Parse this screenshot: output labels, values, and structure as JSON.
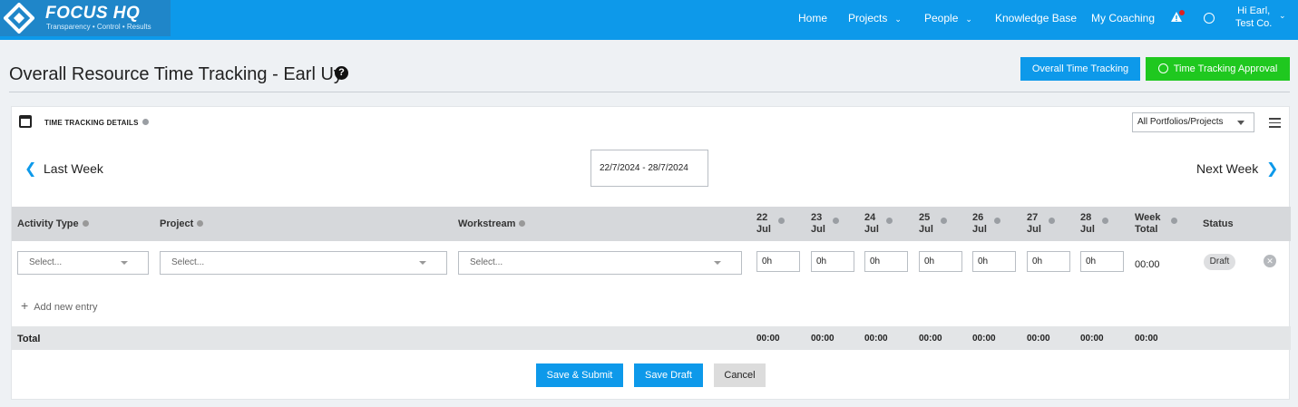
{
  "nav": {
    "logo_title": "FOCUS HQ",
    "logo_tagline": "Transparency • Control • Results",
    "items": [
      {
        "label": "Home"
      },
      {
        "label": "Projects",
        "dropdown": true
      },
      {
        "label": "People",
        "dropdown": true
      },
      {
        "label": "Knowledge Base"
      },
      {
        "label": "My Coaching"
      }
    ],
    "user_line1": "Hi Earl,",
    "user_line2": "Test Co.",
    "icons": [
      "alert-bell-icon",
      "globe-icon",
      "chevron-down-icon"
    ]
  },
  "page": {
    "title": "Overall Resource Time Tracking - Earl Uy",
    "help_symbol": "?",
    "overall_btn": "Overall Time Tracking",
    "approval_btn": "Time Tracking Approval"
  },
  "card": {
    "title": "TIME TRACKING DETAILS",
    "portfolio_select": "All Portfolios/Projects",
    "prev_week": "Last Week",
    "next_week": "Next Week",
    "date_range": "22/7/2024 - 28/7/2024"
  },
  "table": {
    "headers": {
      "activity_type": "Activity Type",
      "project": "Project",
      "workstream": "Workstream",
      "week_total_1": "Week",
      "week_total_2": "Total",
      "status": "Status"
    },
    "days": [
      {
        "day": "22",
        "month": "Jul"
      },
      {
        "day": "23",
        "month": "Jul"
      },
      {
        "day": "24",
        "month": "Jul"
      },
      {
        "day": "25",
        "month": "Jul"
      },
      {
        "day": "26",
        "month": "Jul"
      },
      {
        "day": "27",
        "month": "Jul"
      },
      {
        "day": "28",
        "month": "Jul"
      }
    ],
    "row": {
      "activity_placeholder": "Select...",
      "project_placeholder": "Select...",
      "workstream_placeholder": "Select...",
      "hours": [
        "0h",
        "0h",
        "0h",
        "0h",
        "0h",
        "0h",
        "0h"
      ],
      "week_total": "00:00",
      "status": "Draft"
    },
    "add_entry": "Add new entry",
    "total_label": "Total",
    "totals": [
      "00:00",
      "00:00",
      "00:00",
      "00:00",
      "00:00",
      "00:00",
      "00:00",
      "00:00"
    ]
  },
  "actions": {
    "submit": "Save & Submit",
    "draft": "Save Draft",
    "cancel": "Cancel"
  },
  "colors": {
    "brand": "#0d99ea",
    "approve": "#1fc81f",
    "alert": "#e02020"
  }
}
